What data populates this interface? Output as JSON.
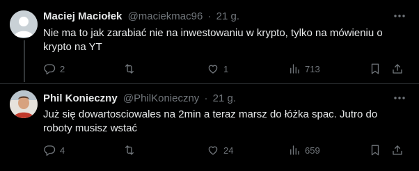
{
  "tweets": [
    {
      "name": "Maciej Maciołek",
      "handle": "@maciekmac96",
      "separator": "·",
      "time": "21 g.",
      "text": "Nie ma to jak zarabiać nie na inwestowaniu w krypto, tylko na mówieniu o krypto na YT",
      "replies": "2",
      "retweets": "",
      "likes": "1",
      "views": "713",
      "avatar_color": "#c9d1d6"
    },
    {
      "name": "Phil Konieczny",
      "handle": "@PhilKonieczny",
      "separator": "·",
      "time": "21 g.",
      "text": "Już się dowartosciowales na 2min a teraz marsz do łóżka spac. Jutro do roboty musisz wstać",
      "replies": "4",
      "retweets": "",
      "likes": "24",
      "views": "659",
      "avatar_color": "#d8d8d8"
    }
  ],
  "colors": {
    "background": "#000000",
    "primary_text": "#e7e9ea",
    "secondary_text": "#71767b",
    "divider": "#2f3336"
  },
  "icons": [
    "avatar-default-icon",
    "more-icon",
    "reply-icon",
    "retweet-icon",
    "like-icon",
    "views-icon",
    "bookmark-icon",
    "share-icon"
  ]
}
